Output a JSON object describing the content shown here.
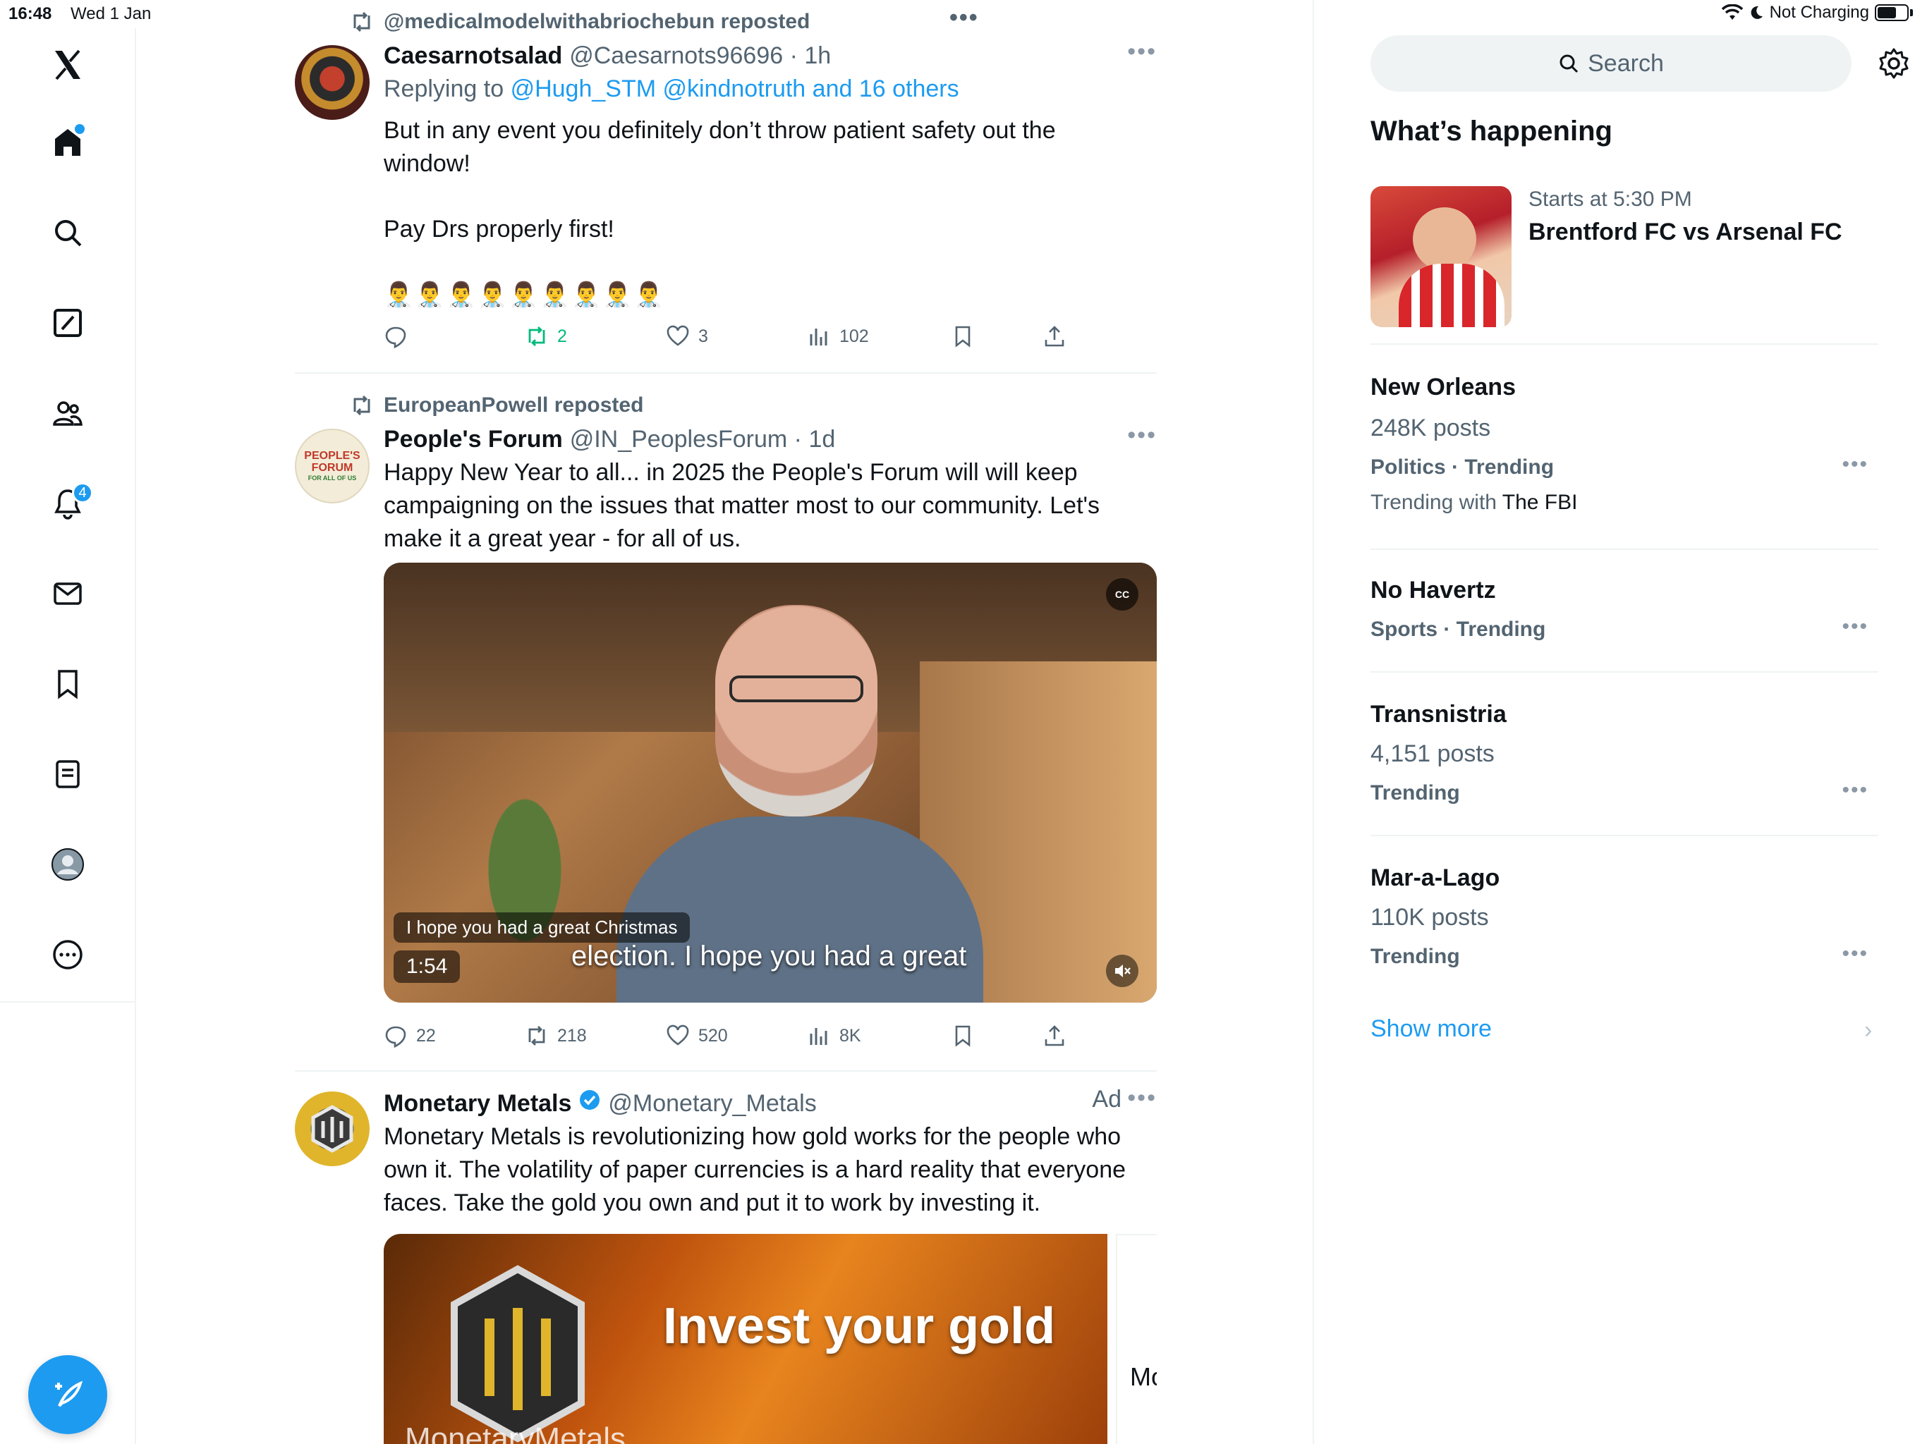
{
  "status": {
    "time": "16:48",
    "date": "Wed 1 Jan",
    "battery_text": "Not Charging",
    "center_dots": "•••"
  },
  "nav": {
    "notifications_badge": "4",
    "items": [
      "x-logo",
      "home",
      "search",
      "grok",
      "communities",
      "notifications",
      "messages",
      "bookmarks",
      "lists",
      "profile",
      "more"
    ]
  },
  "feed": {
    "tweets": [
      {
        "reposted_by": "@medicalmodelwithabriochebun reposted",
        "name": "Caesarnotsalad",
        "handle_time": "@Caesarnots96696 · 1h",
        "reply_prefix": "Replying to",
        "reply_targets": "@Hugh_STM @kindnotruth and 16 others",
        "text_line1": "But in any event you definitely don’t throw patient safety out the window!",
        "text_line2": "Pay Drs properly first!",
        "emojis": "👨‍⚕️👨‍⚕️👨‍⚕️👨‍⚕️👨‍⚕️👨‍⚕️👨‍⚕️👨‍⚕️👨‍⚕️",
        "replies": "",
        "reposts": "2",
        "likes": "3",
        "views": "102"
      },
      {
        "reposted_by": "EuropeanPowell reposted",
        "name": "People's Forum",
        "handle_time": "@IN_PeoplesForum · 1d",
        "text": "Happy New Year to all... in 2025 the People's Forum will will keep campaigning on the issues that matter most to our community. Let's make it a great year - for all of us.",
        "video_caption": "I hope you had a great Christmas",
        "video_subtitle": "election. I hope you had a great",
        "video_duration": "1:54",
        "avatar_text_1": "PEOPLE'S",
        "avatar_text_2": "FORUM",
        "avatar_text_3": "FOR ALL OF US",
        "replies": "22",
        "reposts": "218",
        "likes": "520",
        "views": "8K"
      },
      {
        "name": "Monetary Metals",
        "handle_time": "@Monetary_Metals",
        "ad_label": "Ad",
        "text": "Monetary Metals is revolutionizing how gold works for the people who own it. The volatility of paper currencies is a hard reality that everyone faces. Take the gold you own and put it to work by investing it.",
        "card_headline": "Invest your gold",
        "card_brand": "MonetaryMetals",
        "next_card_text": "Mo"
      }
    ]
  },
  "sidebar": {
    "search_placeholder": "Search",
    "section_title": "What’s happening",
    "event": {
      "subtitle": "Starts at 5:30 PM",
      "title": "Brentford FC vs Arsenal FC"
    },
    "trends": [
      {
        "title": "New Orleans",
        "posts": "248K posts",
        "category": "Politics · Trending",
        "with_prefix": "Trending with",
        "with_value": "The FBI"
      },
      {
        "title": "No Havertz",
        "posts": "",
        "category": "Sports · Trending"
      },
      {
        "title": "Transnistria",
        "posts": "4,151 posts",
        "category": "Trending"
      },
      {
        "title": "Mar-a-Lago",
        "posts": "110K posts",
        "category": "Trending"
      }
    ],
    "show_more": "Show more"
  },
  "colors": {
    "accent": "#1d9bf0",
    "repost_green": "#00ba7c",
    "muted": "#536471"
  }
}
